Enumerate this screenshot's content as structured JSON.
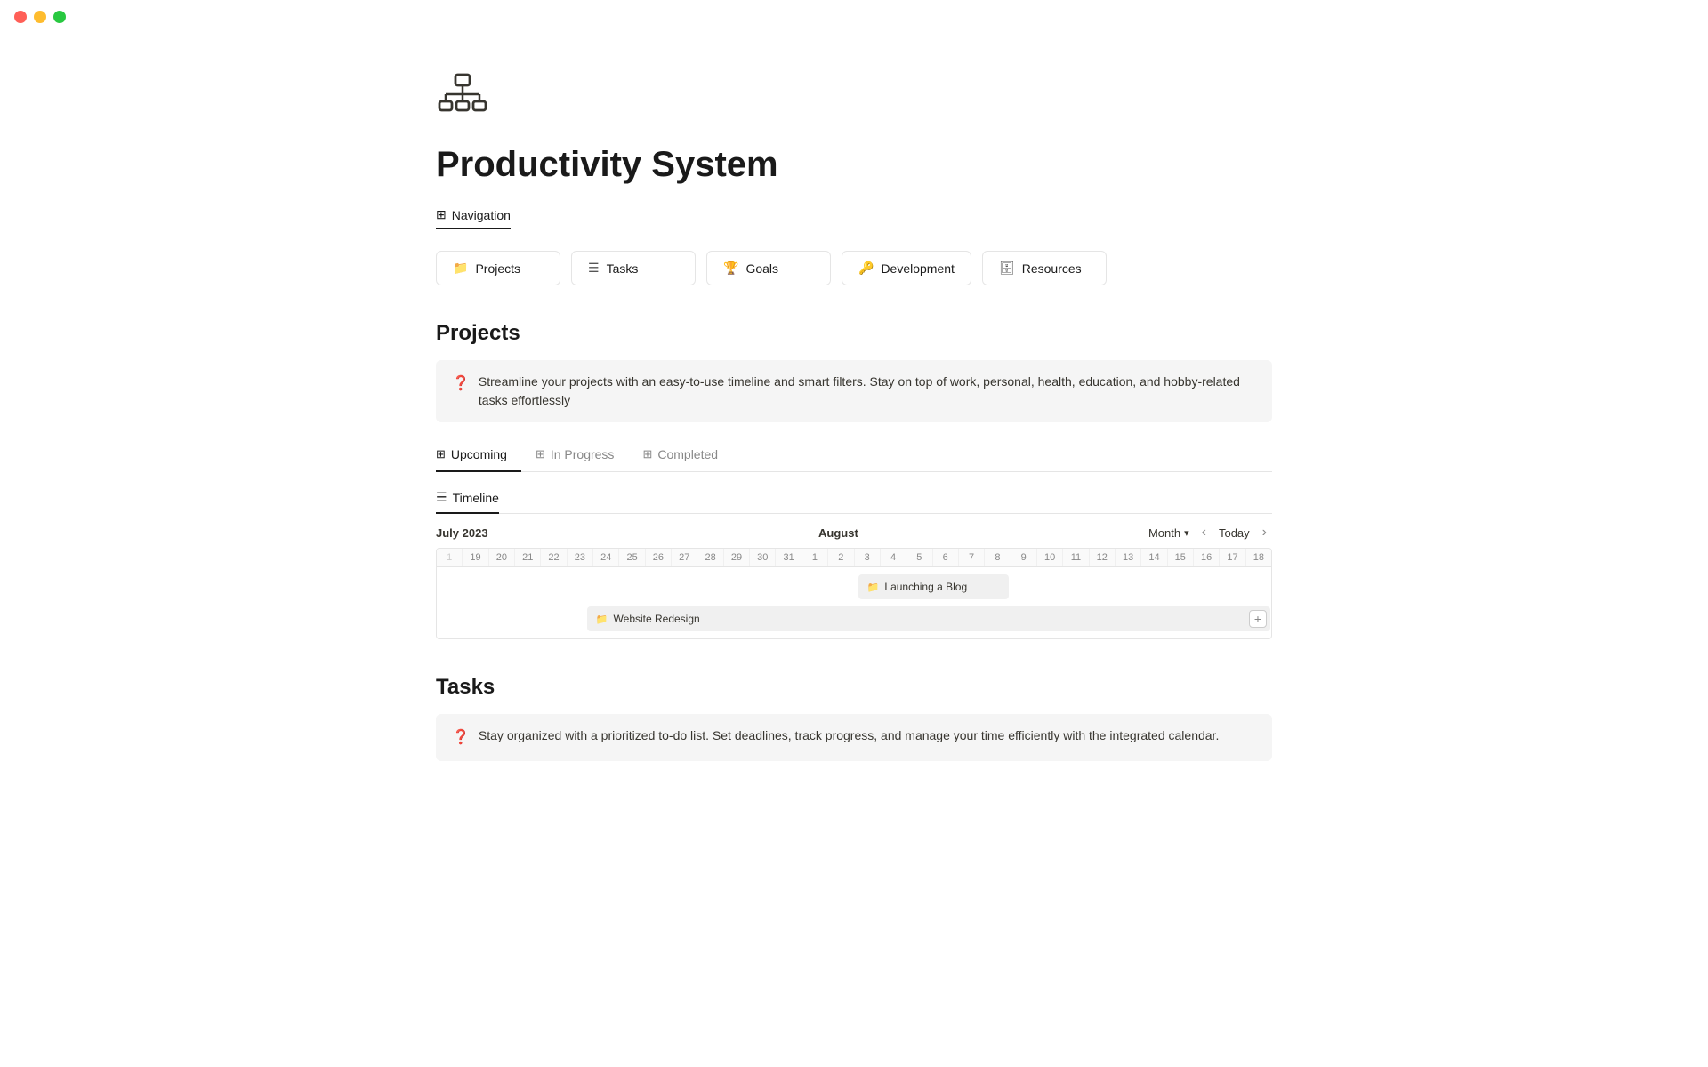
{
  "window": {
    "dot_red": "red",
    "dot_yellow": "yellow",
    "dot_green": "green"
  },
  "page": {
    "title": "Productivity System",
    "icon_label": "network-icon"
  },
  "navigation": {
    "label": "Navigation",
    "cards": [
      {
        "id": "projects",
        "icon": "📁",
        "label": "Projects"
      },
      {
        "id": "tasks",
        "icon": "☰",
        "label": "Tasks"
      },
      {
        "id": "goals",
        "icon": "🏆",
        "label": "Goals"
      },
      {
        "id": "development",
        "icon": "🔑",
        "label": "Development"
      },
      {
        "id": "resources",
        "icon": "🗄",
        "label": "Resources"
      }
    ]
  },
  "projects_section": {
    "title": "Projects",
    "info_text": "Streamline your projects with an easy-to-use timeline and smart filters. Stay on top of work, personal, health, education, and hobby-related tasks effortlessly",
    "tabs": [
      {
        "id": "upcoming",
        "label": "Upcoming",
        "active": true
      },
      {
        "id": "in-progress",
        "label": "In Progress",
        "active": false
      },
      {
        "id": "completed",
        "label": "Completed",
        "active": false
      }
    ],
    "timeline": {
      "label": "Timeline",
      "month_label_july": "July 2023",
      "month_label_august": "August",
      "view_select": "Month",
      "today_btn": "Today",
      "days": [
        "1",
        "19",
        "20",
        "21",
        "22",
        "23",
        "24",
        "25",
        "26",
        "27",
        "28",
        "29",
        "30",
        "31",
        "1",
        "2",
        "3",
        "4",
        "5",
        "6",
        "7",
        "8",
        "9",
        "10",
        "11",
        "12",
        "13",
        "14",
        "15",
        "16",
        "17",
        "18"
      ],
      "events": [
        {
          "id": "launching-blog",
          "icon": "📁",
          "label": "Launching a Blog"
        },
        {
          "id": "website-redesign",
          "icon": "📁",
          "label": "Website Redesign"
        }
      ]
    }
  },
  "tasks_section": {
    "title": "Tasks",
    "info_text": "Stay organized with a prioritized to-do list. Set deadlines, track progress, and manage your time efficiently with the integrated calendar."
  }
}
